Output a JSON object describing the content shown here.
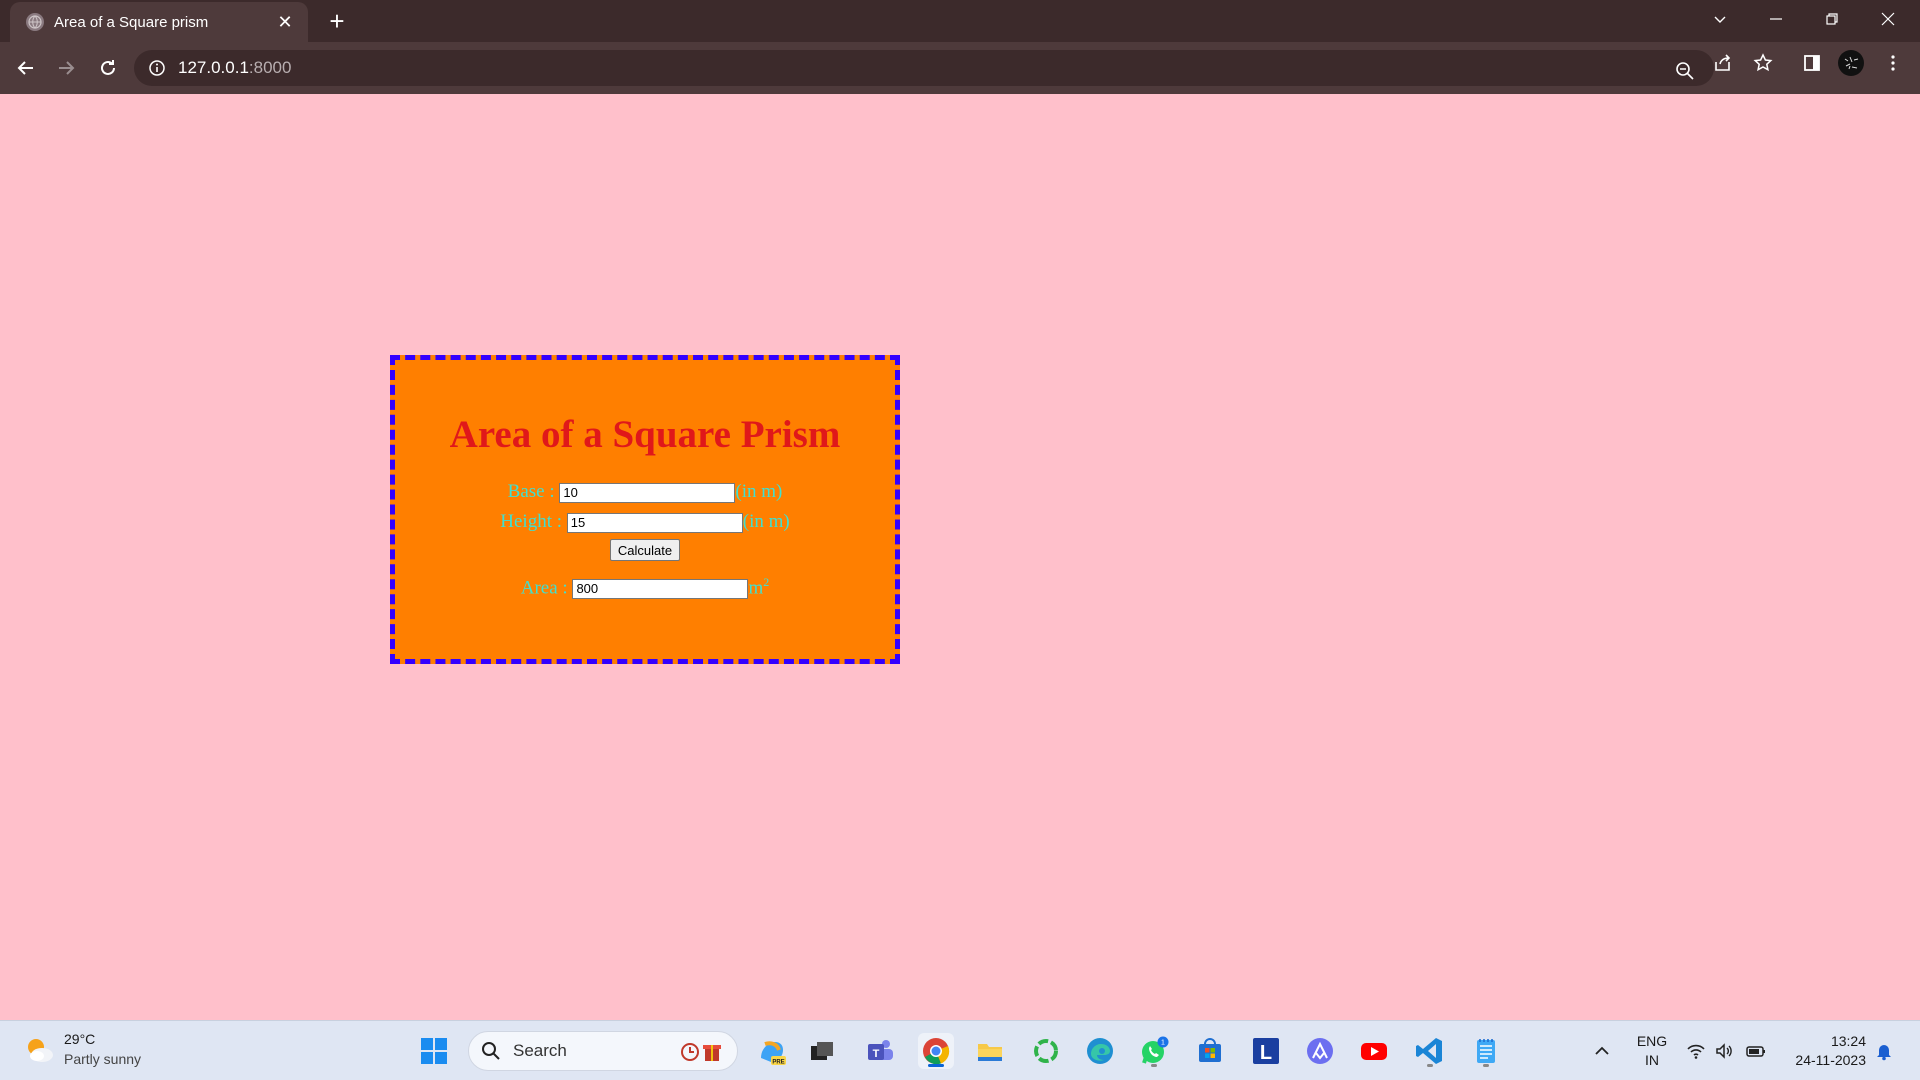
{
  "browser": {
    "tab_title": "Area of a Square prism",
    "url_host": "127.0.0.1",
    "url_port": ":8000"
  },
  "page": {
    "title": "Area of a Square Prism",
    "base_label": "Base :",
    "base_value": "10",
    "base_unit": "(in m)",
    "height_label": "Height :",
    "height_value": "15",
    "height_unit": "(in m)",
    "calculate_label": "Calculate",
    "area_label": "Area :",
    "area_value": "800",
    "area_unit": "m",
    "area_unit_sup": "2",
    "colors": {
      "background": "#ffc0cb",
      "box": "#ff7f00",
      "border": "#3300ff",
      "title": "#e0181a",
      "labels": "#40e0d0"
    }
  },
  "taskbar": {
    "weather_temp": "29°C",
    "weather_desc": "Partly sunny",
    "search_placeholder": "Search",
    "lang_top": "ENG",
    "lang_bottom": "IN",
    "time": "13:24",
    "date": "24-11-2023",
    "whatsapp_badge": "1",
    "pinned_apps": [
      "start",
      "search",
      "widgets",
      "copilot-pre",
      "task-view",
      "teams",
      "chrome",
      "file-explorer",
      "refresh-app",
      "edge",
      "whatsapp",
      "microsoft-store",
      "l-app",
      "arc-app",
      "youtube",
      "vscode",
      "notepad"
    ]
  }
}
